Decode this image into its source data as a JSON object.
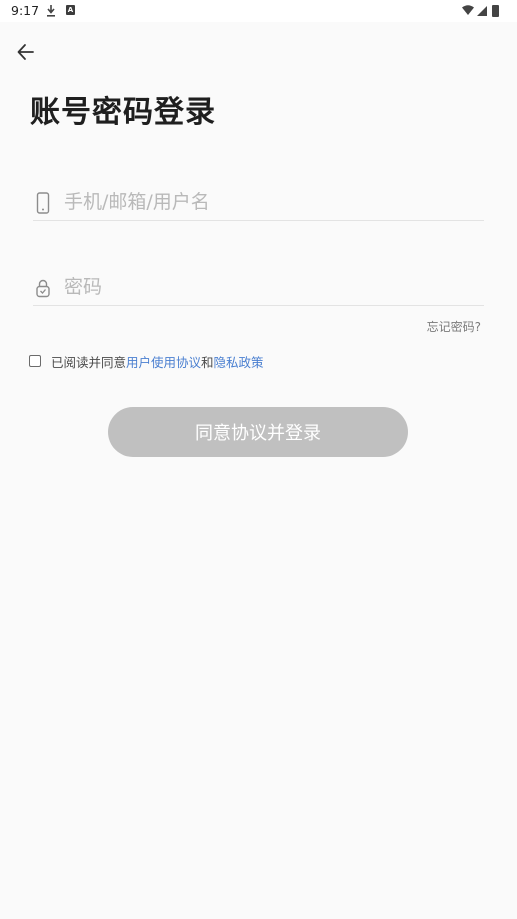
{
  "status_bar": {
    "time": "9:17",
    "icons": [
      "download-icon",
      "a-notification-icon",
      "wifi-icon",
      "cell-signal-icon",
      "battery-icon"
    ]
  },
  "header": {
    "back_icon": "arrow-left-icon",
    "title": "账号密码登录"
  },
  "form": {
    "account": {
      "icon": "phone-icon",
      "placeholder": "手机/邮箱/用户名",
      "value": ""
    },
    "password": {
      "icon": "lock-icon",
      "placeholder": "密码",
      "value": ""
    },
    "forgot_label": "忘记密码?"
  },
  "agreement": {
    "checked": false,
    "prefix": "已阅读并同意",
    "user_agreement": "用户使用协议",
    "and": "和",
    "privacy_policy": "隐私政策"
  },
  "login_button": {
    "label": "同意协议并登录"
  },
  "colors": {
    "link": "#4a7fd0",
    "button_disabled": "#c0c0c0",
    "background": "#fafafa"
  }
}
